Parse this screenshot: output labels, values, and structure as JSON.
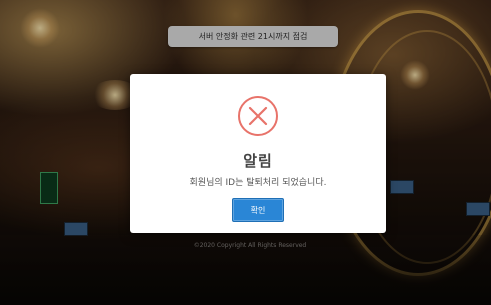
{
  "notice": {
    "text": "서버 안정화 관련 21시까지 점검"
  },
  "footer": {
    "copyright": "©2020 Copyright All Rights Reserved"
  },
  "modal": {
    "icon": "error-x-circle-icon",
    "icon_color": "#e8736a",
    "title": "알림",
    "message": "회원님의 ID는 탈퇴처리 되었습니다.",
    "confirm_label": "확인",
    "button_color": "#2a86d6"
  }
}
